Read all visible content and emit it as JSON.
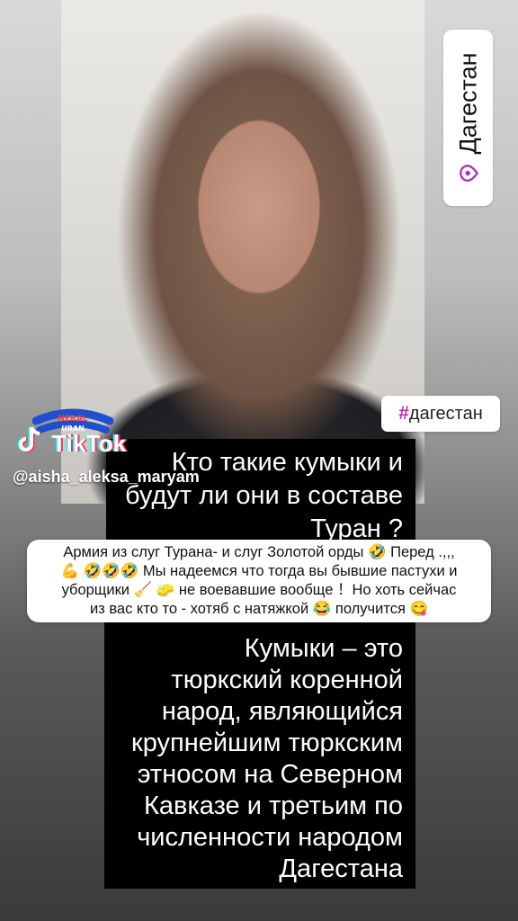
{
  "location_sticker": {
    "icon": "location-pin-icon",
    "label": "Дагестан",
    "accent_color": "#b42fb8"
  },
  "hashtag_sticker": {
    "hash": "#",
    "label": "дагестан"
  },
  "tiktok": {
    "badge_text": "NERAL TURAN",
    "wordmark": "TikTok",
    "handle": "@aisha_aleksa_maryam"
  },
  "question": {
    "line1": "Кто такие кумыки и",
    "line2": "будут ли они в составе",
    "line3": "Туран ?"
  },
  "reply": {
    "line1": "Армия из слуг Турана- и слуг Золотой орды 🤣 Перед .,,,",
    "line2": "💪 🤣🤣🤣 Мы надеемся что тогда вы бывшие пастухи и",
    "line3": "уборщики 🧹 🧽 не воевавшие вообще ！Но хоть сейчас",
    "line4": "из вас кто то - хотяб с натяжкой 😂 получится 😋"
  },
  "answer": {
    "lines": [
      "Кумыки – это",
      "тюркский коренной",
      "народ, являющийся",
      "крупнейшим тюркским",
      "этносом на Северном",
      "Кавказе и третьим по",
      "численности народом",
      "Дагестана"
    ]
  }
}
